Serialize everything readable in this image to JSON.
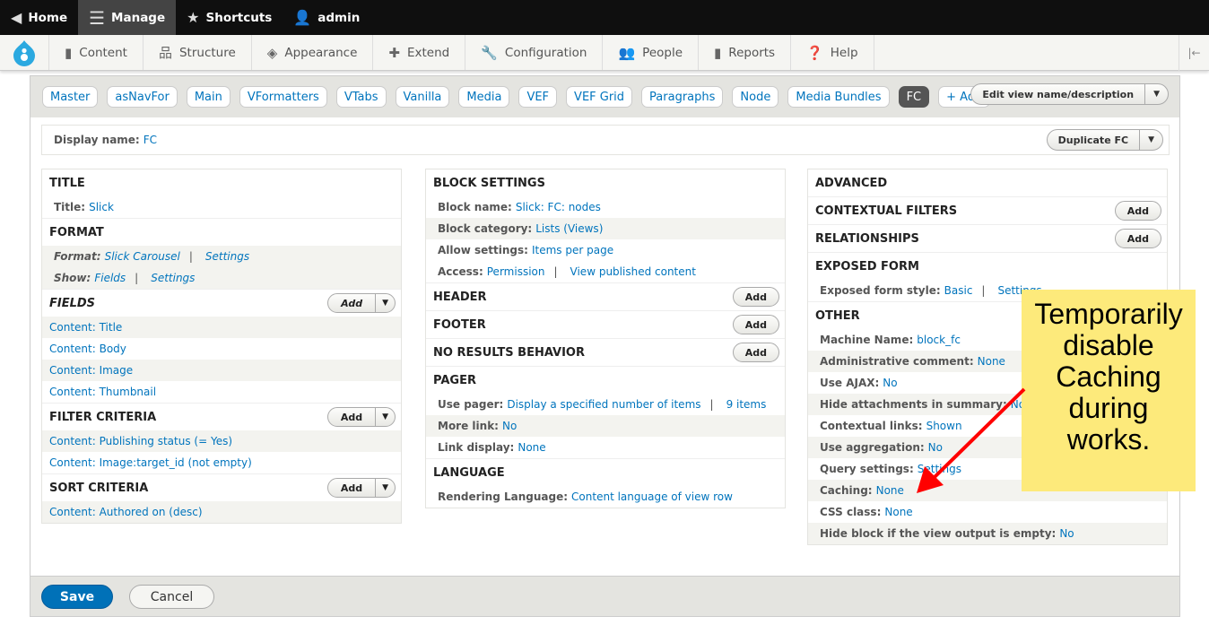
{
  "toolbar": {
    "home": "Home",
    "manage": "Manage",
    "shortcuts": "Shortcuts",
    "user": "admin"
  },
  "admin_menu": [
    "Content",
    "Structure",
    "Appearance",
    "Extend",
    "Configuration",
    "People",
    "Reports",
    "Help"
  ],
  "display_tabs": [
    "Master",
    "asNavFor",
    "Main",
    "VFormatters",
    "VTabs",
    "Vanilla",
    "Media",
    "VEF",
    "VEF Grid",
    "Paragraphs",
    "Node",
    "Media Bundles",
    "FC"
  ],
  "active_tab": "FC",
  "add_display": "+ Add",
  "edit_view_button": "Edit view name/description",
  "display_name": {
    "label": "Display name:",
    "value": "FC"
  },
  "duplicate_button": "Duplicate FC",
  "add_label": "Add",
  "columns": [
    [
      {
        "h": "TITLE"
      },
      {
        "label": "Title:",
        "links": [
          "Slick"
        ]
      },
      {
        "h": "FORMAT"
      },
      {
        "label": "Format:",
        "links": [
          "Slick Carousel",
          "Settings"
        ],
        "italic": true,
        "shaded": true
      },
      {
        "label": "Show:",
        "links": [
          "Fields",
          "Settings"
        ],
        "italic": true,
        "shaded": true
      },
      {
        "h": "FIELDS",
        "italic": true,
        "split": true
      },
      {
        "links": [
          "Content: Title"
        ],
        "shaded": true
      },
      {
        "links": [
          "Content: Body"
        ]
      },
      {
        "links": [
          "Content: Image"
        ],
        "shaded": true
      },
      {
        "links": [
          "Content: Thumbnail"
        ]
      },
      {
        "h": "FILTER CRITERIA",
        "split": true
      },
      {
        "links": [
          "Content: Publishing status (= Yes)"
        ],
        "shaded": true
      },
      {
        "links": [
          "Content: Image:target_id (not empty)"
        ]
      },
      {
        "h": "SORT CRITERIA",
        "split": true
      },
      {
        "links": [
          "Content: Authored on (desc)"
        ],
        "shaded": true
      }
    ],
    [
      {
        "h": "BLOCK SETTINGS"
      },
      {
        "label": "Block name:",
        "links": [
          "Slick: FC: nodes"
        ]
      },
      {
        "label": "Block category:",
        "links": [
          "Lists (Views)"
        ],
        "shaded": true
      },
      {
        "label": "Allow settings:",
        "links": [
          "Items per page"
        ]
      },
      {
        "label": "Access:",
        "links": [
          "Permission",
          "View published content"
        ]
      },
      {
        "h": "HEADER",
        "add": true
      },
      {
        "h": "FOOTER",
        "add": true
      },
      {
        "h": "NO RESULTS BEHAVIOR",
        "add": true
      },
      {
        "h": "PAGER"
      },
      {
        "label": "Use pager:",
        "links": [
          "Display a specified number of items",
          "9 items"
        ]
      },
      {
        "label": "More link:",
        "links": [
          "No"
        ],
        "shaded": true
      },
      {
        "label": "Link display:",
        "links": [
          "None"
        ]
      },
      {
        "h": "LANGUAGE"
      },
      {
        "label": "Rendering Language:",
        "links": [
          "Content language of view row"
        ]
      }
    ],
    [
      {
        "h": "ADVANCED"
      },
      {
        "h": "CONTEXTUAL FILTERS",
        "add": true
      },
      {
        "h": "RELATIONSHIPS",
        "add": true
      },
      {
        "h": "EXPOSED FORM"
      },
      {
        "label": "Exposed form style:",
        "links": [
          "Basic",
          "Settings"
        ]
      },
      {
        "h": "OTHER"
      },
      {
        "label": "Machine Name:",
        "links": [
          "block_fc"
        ]
      },
      {
        "label": "Administrative comment:",
        "links": [
          "None"
        ],
        "shaded": true
      },
      {
        "label": "Use AJAX:",
        "links": [
          "No"
        ]
      },
      {
        "label": "Hide attachments in summary:",
        "links": [
          "No"
        ],
        "shaded": true
      },
      {
        "label": "Contextual links:",
        "links": [
          "Shown"
        ]
      },
      {
        "label": "Use aggregation:",
        "links": [
          "No"
        ],
        "shaded": true
      },
      {
        "label": "Query settings:",
        "links": [
          "Settings"
        ]
      },
      {
        "label": "Caching:",
        "links": [
          "None"
        ],
        "shaded": true
      },
      {
        "label": "CSS class:",
        "links": [
          "None"
        ]
      },
      {
        "label": "Hide block if the view output is empty:",
        "links": [
          "No"
        ],
        "shaded": true
      }
    ]
  ],
  "footer": {
    "save": "Save",
    "cancel": "Cancel"
  },
  "annotation": {
    "text": "Temporarily disable Caching during works.",
    "lines": [
      "Temporarily",
      "disable",
      "Caching",
      "during",
      "works."
    ],
    "color": "#fdea7b",
    "arrow_color": "#ff0000"
  }
}
